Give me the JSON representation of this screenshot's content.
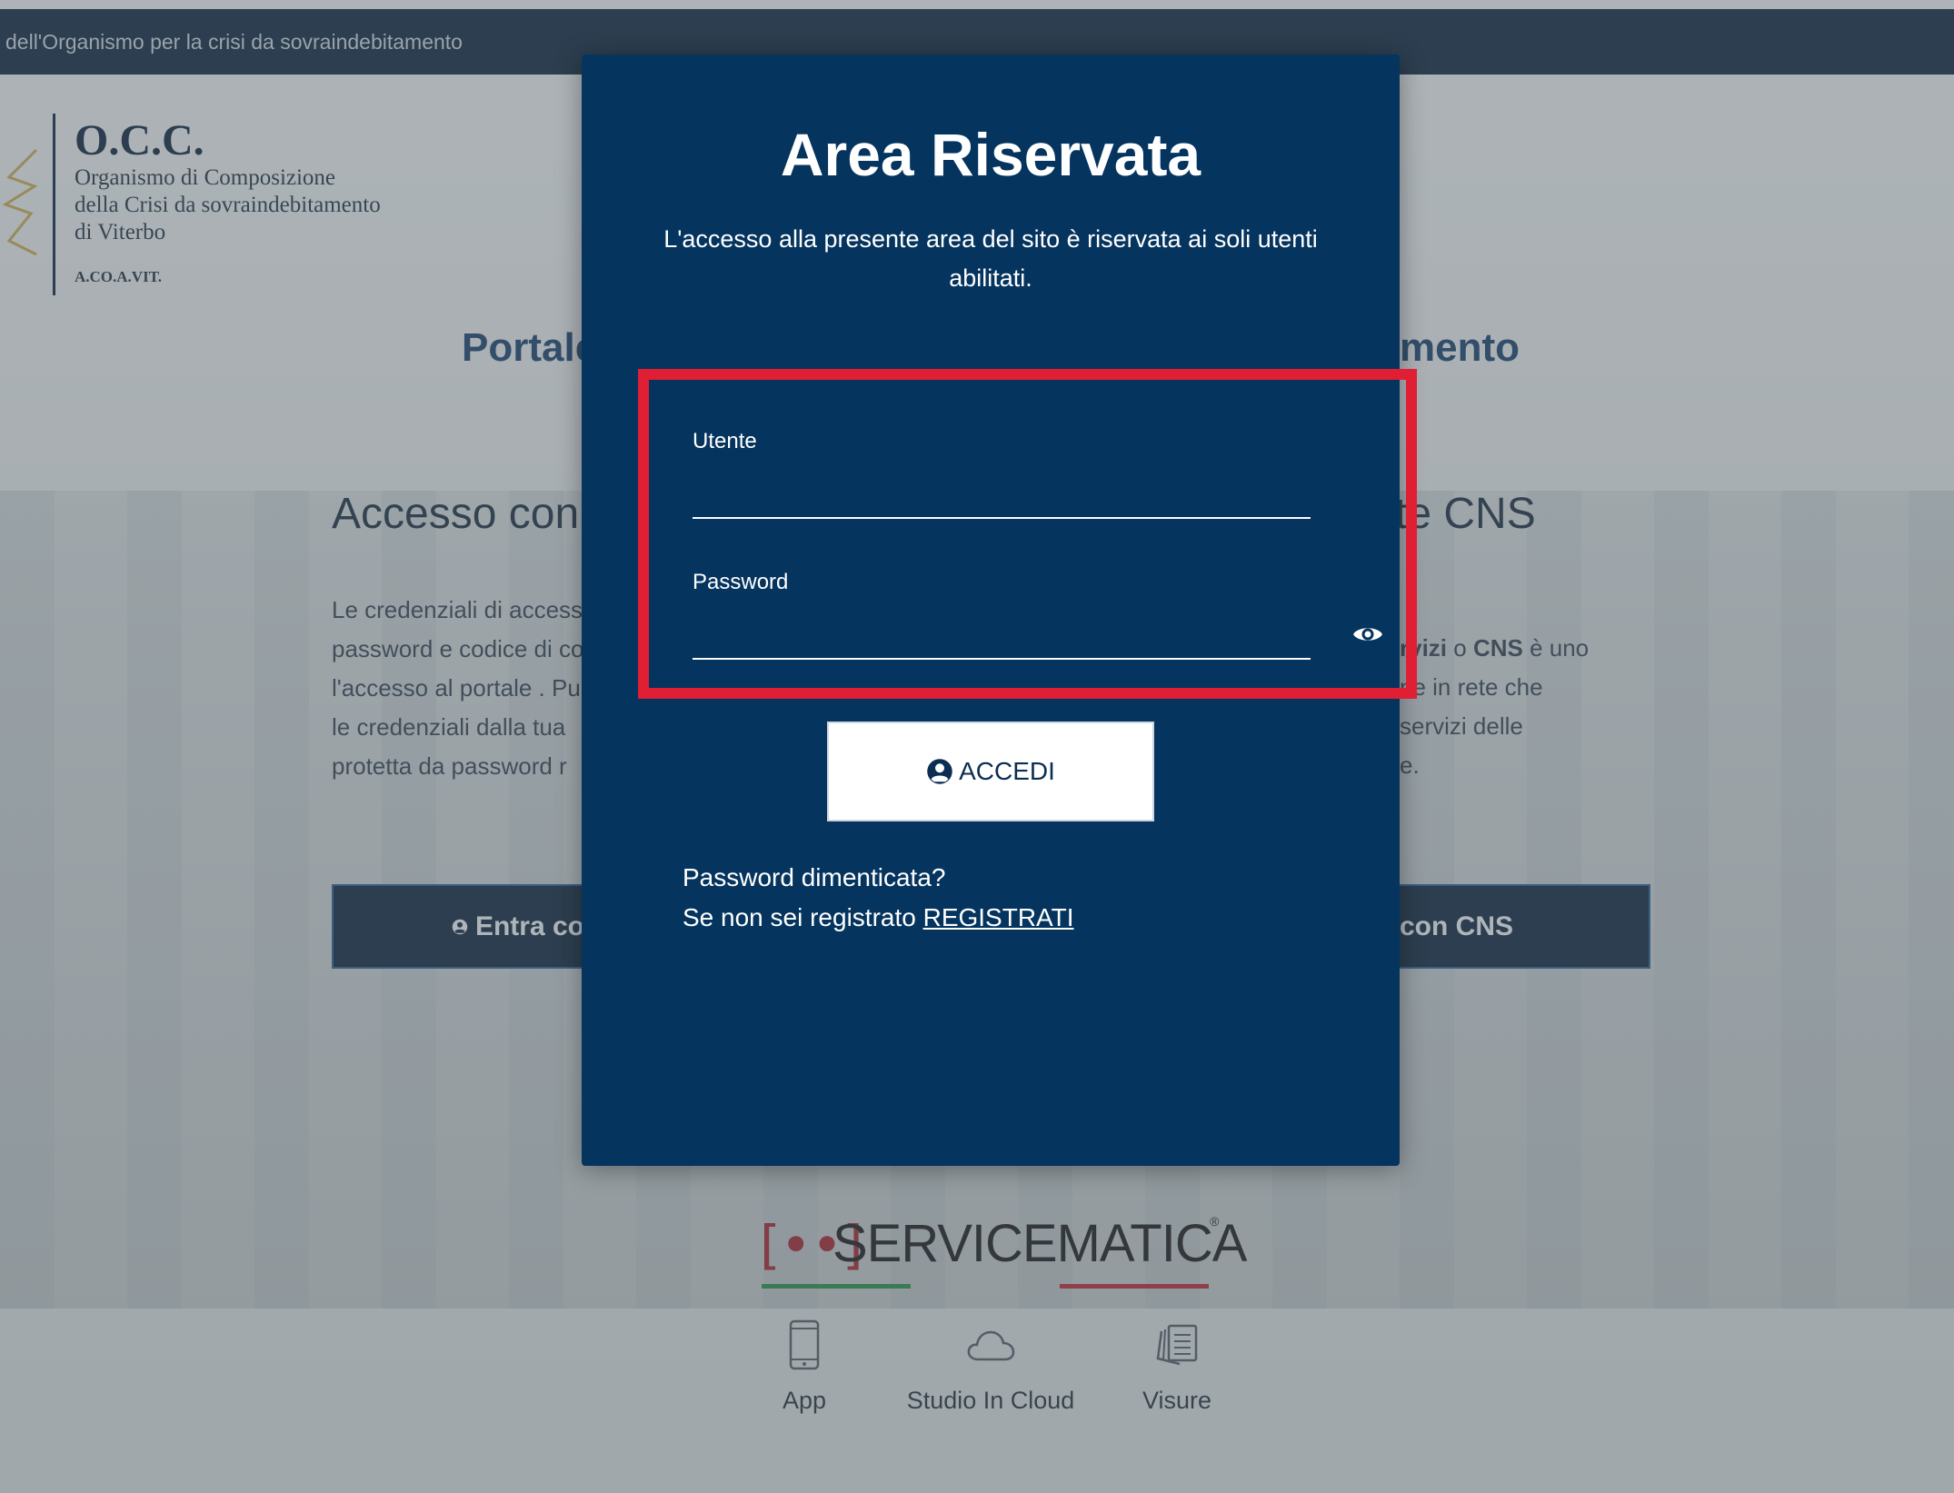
{
  "background": {
    "topbar_text": "dell'Organismo per la crisi da sovraindebitamento",
    "logo": {
      "title": "O.C.C.",
      "line1": "Organismo di Composizione",
      "line2": "della Crisi da sovraindebitamento",
      "line3": "di Viterbo",
      "abbr": "A.CO.A.VIT."
    },
    "portal_left": "Portale",
    "portal_right": "mento",
    "accesso_left": "Accesso con",
    "accesso_right": "te CNS",
    "para_left": [
      "Le credenziali di access",
      "password e codice di co",
      "l'accesso al portale . Pu",
      "le credenziali dalla tua",
      "protetta da password r"
    ],
    "para_right": {
      "l1_b1": "rvizi",
      "l1_t1": " o ",
      "l1_b2": "CNS",
      "l1_t2": " è uno",
      "l2": "ne in rete che",
      "l3": "servizi delle",
      "l4": "e."
    },
    "btn_left": "Entra co",
    "btn_right": "con CNS"
  },
  "modal": {
    "title": "Area Riservata",
    "description": "L'accesso alla presente area del sito è riservata ai soli utenti abilitati.",
    "user_label": "Utente",
    "user_value": "",
    "password_label": "Password",
    "password_value": "",
    "accedi_label": "ACCEDI",
    "forgot_text": "Password dimenticata?",
    "register_prefix": "Se non sei registrato ",
    "register_link": "REGISTRATI",
    "highlight_color": "#e01e34",
    "bg_color": "#05345e"
  },
  "servicematica": {
    "bracket": "[••]",
    "name": "SERVICEMATICA",
    "registered": "®",
    "items": [
      {
        "label": "App",
        "icon": "smartphone-icon"
      },
      {
        "label": "Studio In Cloud",
        "icon": "cloud-icon"
      },
      {
        "label": "Visure",
        "icon": "documents-icon"
      }
    ]
  }
}
